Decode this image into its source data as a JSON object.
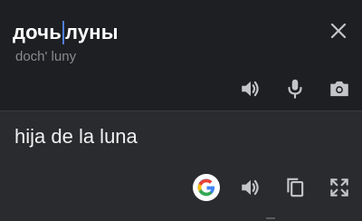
{
  "source": {
    "text_before_caret": "дочь",
    "text_after_caret": "луны",
    "transliteration": "doch' luny"
  },
  "target": {
    "text": "hija de la luna"
  },
  "colors": {
    "background": "#1e1f22",
    "target_background": "#2a2b2f",
    "caret": "#4f7fd9",
    "icon": "#c4c5c9"
  },
  "icons": {
    "close": "close-icon",
    "source_speaker": "speaker-icon",
    "mic": "microphone-icon",
    "camera": "camera-icon",
    "google": "google-icon",
    "target_speaker": "speaker-icon",
    "copy": "copy-icon",
    "fullscreen": "fullscreen-icon"
  }
}
